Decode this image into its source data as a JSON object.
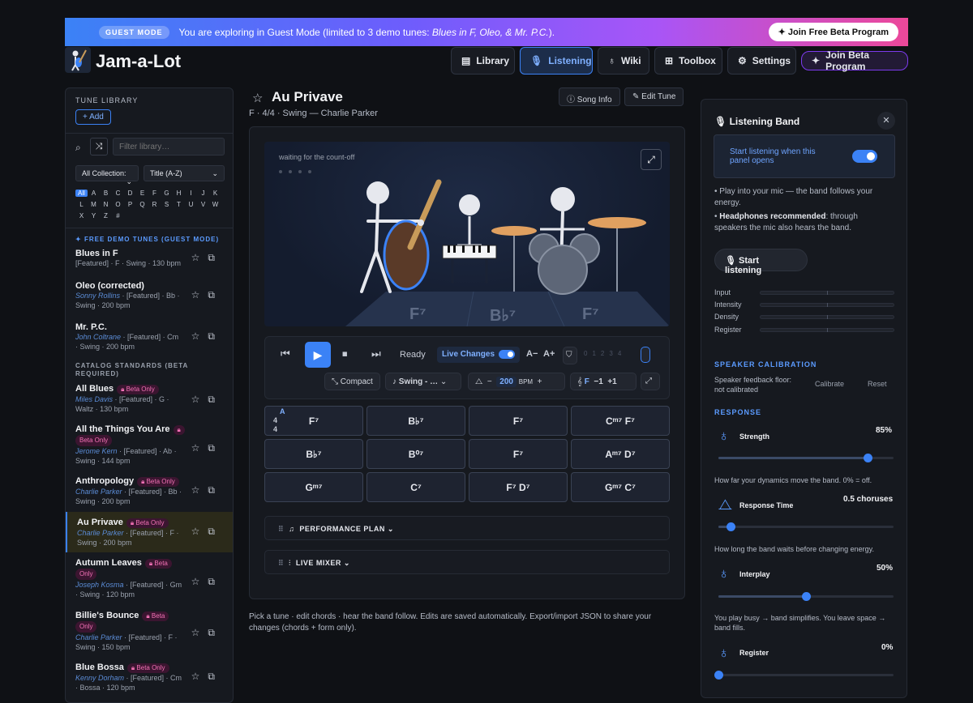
{
  "banner": {
    "badge": "GUEST MODE",
    "msg_pre": "You are exploring in Guest Mode (limited to 3 demo tunes: ",
    "msg_tunes": "Blues in F, Oleo, & Mr. P.C.",
    "msg_post": ").",
    "join": "Join Free Beta Program"
  },
  "app": {
    "title": "Jam-a-Lot"
  },
  "nav": {
    "library": "Library",
    "listening": "Listening",
    "wiki": "Wiki",
    "toolbox": "Toolbox",
    "settings": "Settings",
    "beta": "Join Beta Program"
  },
  "sidebar": {
    "title": "TUNE LIBRARY",
    "add": "Add",
    "filter_placeholder": "Filter library…",
    "collection": "All Collection:",
    "sort": "Title (A-Z)",
    "letters": [
      "All",
      "A",
      "B",
      "C",
      "D",
      "E",
      "F",
      "G",
      "H",
      "I",
      "J",
      "K",
      "L",
      "M",
      "N",
      "O",
      "P",
      "Q",
      "R",
      "S",
      "T",
      "U",
      "V",
      "W",
      "X",
      "Y",
      "Z",
      "#"
    ],
    "demo_header": "FREE DEMO TUNES (GUEST MODE)",
    "catalog_header_1": "CATALOG STANDARDS (BETA",
    "catalog_header_2": "REQUIRED)",
    "beta_pill": "Beta Only",
    "tunes": [
      {
        "title": "Blues in F",
        "l1": "[Featured] · F · Swing · 130 bpm"
      },
      {
        "title": "Oleo (corrected)",
        "composer": "Sonny Rollins",
        "l1": " · [Featured] · Bb ·",
        "l2": "Swing · 200 bpm"
      },
      {
        "title": "Mr. P.C.",
        "composer": "John Coltrane",
        "l1": " · [Featured] · Cm",
        "l2": "· Swing · 200 bpm"
      },
      {
        "title": "All Blues",
        "composer": "Miles Davis",
        "l1": " · [Featured] · G ·",
        "l2": "Waltz · 130 bpm"
      },
      {
        "title": "All the Things You Are",
        "composer": "Jerome Kern",
        "l1": " · [Featured] · Ab ·",
        "l2": "Swing · 144 bpm"
      },
      {
        "title": "Anthropology",
        "composer": "Charlie Parker",
        "l1": " · [Featured] · Bb ·",
        "l2": "Swing · 200 bpm"
      },
      {
        "title": "Au Privave",
        "composer": "Charlie Parker",
        "l1": " · [Featured] · F ·",
        "l2": "Swing · 200 bpm"
      },
      {
        "title": "Autumn Leaves",
        "composer": "Joseph Kosma",
        "l1": " · [Featured] · Gm",
        "l2": "· Swing · 120 bpm",
        "pill1": "Beta",
        "pill2": "Only"
      },
      {
        "title": "Billie's Bounce",
        "composer": "Charlie Parker",
        "l1": " · [Featured] · F ·",
        "l2": "Swing · 150 bpm",
        "pill1": "Beta",
        "pill2": "Only"
      },
      {
        "title": "Blue Bossa",
        "composer": "Kenny Dorham",
        "l1": " · [Featured] · Cm",
        "l2": "· Bossa · 120 bpm"
      }
    ]
  },
  "song": {
    "title": "Au Privave",
    "subtitle": "F · 4/4 · Swing — Charlie Parker",
    "song_info": "Song Info",
    "edit_tune": "Edit Tune"
  },
  "stage": {
    "status": "waiting for the count-off",
    "chords": [
      "F⁷",
      "B♭⁷",
      "F⁷"
    ]
  },
  "transport": {
    "ready": "Ready",
    "live_changes": "Live Changes",
    "a_minus": "A−",
    "a_plus": "A+",
    "compact": "Compact",
    "style": "Swing - …",
    "bpm": "200",
    "bpm_unit": "BPM",
    "key": "F",
    "minus_one": "−1",
    "plus_one": "+1",
    "counts": [
      "0",
      "1",
      "2",
      "3",
      "4"
    ]
  },
  "grid": {
    "cells": [
      "F⁷",
      "B♭⁷",
      "F⁷",
      "Cᵐ⁷  F⁷",
      "B♭⁷",
      "B⁰⁷",
      "F⁷",
      "Aᵐ⁷  D⁷",
      "Gᵐ⁷",
      "C⁷",
      "F⁷  D⁷",
      "Gᵐ⁷  C⁷"
    ],
    "ts_top": "A",
    "ts_num": "4",
    "ts_den": "4"
  },
  "sections": {
    "plan": "PERFORMANCE PLAN",
    "mixer": "LIVE MIXER"
  },
  "footnote": "Pick a tune · edit chords · hear the band follow. Edits are saved automatically. Export/import JSON to share your changes (chords + form only).",
  "panel": {
    "title": "Listening Band",
    "auto": "Start listening when this panel opens",
    "bullet1": "Play into your mic — the band follows your energy.",
    "bullet2_b": "Headphones recommended",
    "bullet2_r": ": through speakers the mic also hears the band.",
    "start": "Start listening",
    "meters": [
      "Input",
      "Intensity",
      "Density",
      "Register"
    ],
    "calib_title": "SPEAKER CALIBRATION",
    "calib_text": "Speaker feedback floor: not calibrated",
    "calibrate": "Calibrate",
    "reset": "Reset",
    "response_title": "RESPONSE",
    "strength": {
      "name": "Strength",
      "value": "85%",
      "level": 0.85,
      "desc": "How far your dynamics move the band. 0% = off."
    },
    "response_time": {
      "name": "Response Time",
      "value": "0.5 choruses",
      "level": 0.07,
      "desc": "How long the band waits before changing energy."
    },
    "interplay": {
      "name": "Interplay",
      "value": "50%",
      "level": 0.5,
      "desc": "You play busy → band simplifies. You leave space → band fills."
    },
    "register": {
      "name": "Register",
      "value": "0%",
      "level": 0.0
    }
  }
}
